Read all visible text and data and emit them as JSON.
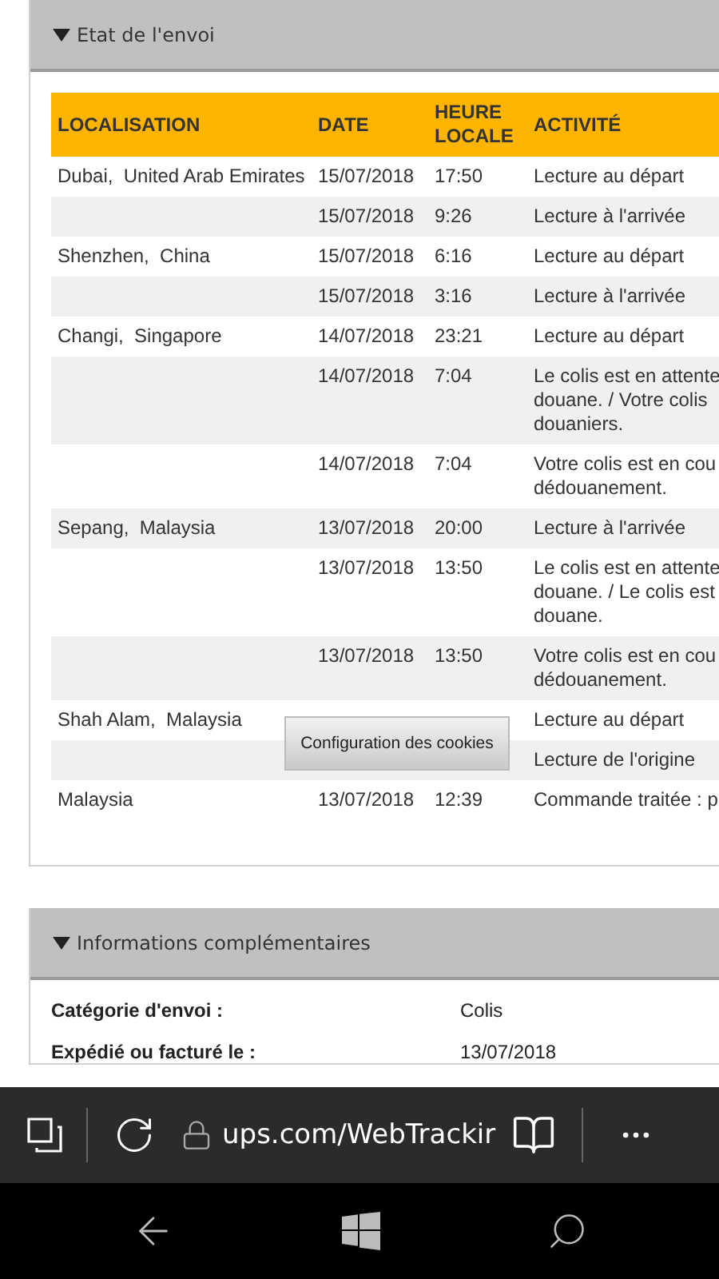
{
  "tracking_panel": {
    "title": "Etat de l'envoi",
    "expanded": true,
    "table": {
      "columns": [
        "LOCALISATION",
        "DATE",
        "HEURE\nLOCALE",
        "ACTIVITÉ"
      ],
      "rows": [
        {
          "location": "Dubai,  United Arab Emirates",
          "date": "15/07/2018",
          "time": "17:50",
          "activity": "Lecture au départ"
        },
        {
          "date": "15/07/2018",
          "time": "9:26",
          "activity": "Lecture à l'arrivée"
        },
        {
          "location": "Shenzhen,  China",
          "date": "15/07/2018",
          "time": "6:16",
          "activity": "Lecture au départ"
        },
        {
          "date": "15/07/2018",
          "time": "3:16",
          "activity": "Lecture à l'arrivée"
        },
        {
          "location": "Changi,  Singapore",
          "date": "14/07/2018",
          "time": "23:21",
          "activity": "Lecture au départ"
        },
        {
          "date": "14/07/2018",
          "time": "7:04",
          "activity": "Le colis est en attente\ndouane. / Votre colis\ndouaniers."
        },
        {
          "date": "14/07/2018",
          "time": "7:04",
          "activity": "Votre colis est en cou\ndédouanement."
        },
        {
          "location": "Sepang,  Malaysia",
          "date": "13/07/2018",
          "time": "20:00",
          "activity": "Lecture à l'arrivée"
        },
        {
          "date": "13/07/2018",
          "time": "13:50",
          "activity": "Le colis est en attente\ndouane. / Le colis est\ndouane."
        },
        {
          "date": "13/07/2018",
          "time": "13:50",
          "activity": "Votre colis est en cou\ndédouanement."
        },
        {
          "location": "Shah Alam,  Malaysia",
          "activity": "Lecture au départ"
        },
        {
          "activity": "Lecture de l'origine"
        },
        {
          "location": "Malaysia",
          "date": "13/07/2018",
          "time": "12:39",
          "activity": "Commande traitée : p"
        }
      ]
    }
  },
  "cookie_button": "Configuration des cookies",
  "info_panel": {
    "title": "Informations complémentaires",
    "expanded": true,
    "rows": [
      {
        "label": "Catégorie d'envoi :",
        "value": "Colis"
      },
      {
        "label": "Expédié ou facturé le :",
        "value": "13/07/2018"
      }
    ]
  },
  "address_bar": {
    "url": "ups.com/WebTrackir"
  }
}
